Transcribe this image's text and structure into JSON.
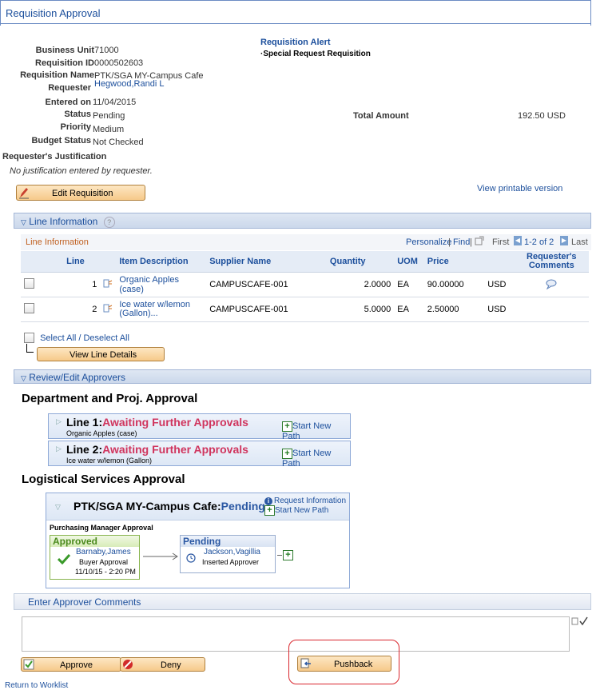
{
  "page": {
    "title": "Requisition Approval"
  },
  "header": {
    "business_unit_label": "Business Unit",
    "business_unit": "71000",
    "requisition_id_label": "Requisition ID",
    "requisition_id": "0000502603",
    "requisition_name_label": "Requisition Name",
    "requisition_name": "PTK/SGA MY-Campus Cafe",
    "requester_label": "Requester",
    "requester": "Hegwood,Randi L",
    "entered_on_label": "Entered on",
    "entered_on": "11/04/2015",
    "status_label": "Status",
    "status": "Pending",
    "priority_label": "Priority",
    "priority": "Medium",
    "budget_status_label": "Budget Status",
    "budget_status": "Not Checked",
    "justification_label": "Requester's Justification",
    "justification": "No justification entered by requester.",
    "alert_title": "Requisition Alert",
    "alert_text": "·Special Request Requisition",
    "total_label": "Total Amount",
    "total": "192.50 USD",
    "edit_button": "Edit Requisition",
    "printable": "View printable version"
  },
  "line_info": {
    "section_title": "Line Information",
    "grid_title": "Line Information",
    "personalize": "Personalize",
    "find": "Find",
    "first": "First",
    "range": "1-2 of 2",
    "last": "Last",
    "columns": [
      "Line",
      "Item Description",
      "Supplier Name",
      "Quantity",
      "UOM",
      "Price",
      "Requester's Comments"
    ],
    "rows": [
      {
        "line": "1",
        "desc": "Organic Apples (case)",
        "supplier": "CAMPUSCAFE-001",
        "qty": "2.0000",
        "uom": "EA",
        "price": "90.00000",
        "cur": "USD"
      },
      {
        "line": "2",
        "desc": "Ice water w/lemon (Gallon)...",
        "supplier": "CAMPUSCAFE-001",
        "qty": "5.0000",
        "uom": "EA",
        "price": "2.50000",
        "cur": "USD"
      }
    ],
    "select_all": "Select All / Deselect All",
    "view_details": "View Line Details"
  },
  "approvers": {
    "section_title": "Review/Edit Approvers",
    "dept_title": "Department and Proj. Approval",
    "line1_prefix": "Line 1:",
    "line1_status": "Awaiting Further Approvals",
    "line1_desc": "Organic Apples (case)",
    "line2_prefix": "Line 2:",
    "line2_status": "Awaiting Further Approvals",
    "line2_desc": "Ice water w/lemon (Gallon)",
    "start_new_path": "Start New Path",
    "log_title": "Logistical Services Approval",
    "log_name": "PTK/SGA MY-Campus Cafe:",
    "log_status": "Pending",
    "request_info": "Request Information",
    "stage": "Purchasing Manager Approval",
    "approved_header": "Approved",
    "approved_name": "Barnaby,James",
    "approved_role": "Buyer Approval",
    "approved_date": "11/10/15 - 2:20 PM",
    "pending_header": "Pending",
    "pending_name": "Jackson,Vagillia",
    "pending_role": "Inserted Approver"
  },
  "comments": {
    "section_title": "Enter Approver Comments",
    "value": ""
  },
  "actions": {
    "approve": "Approve",
    "deny": "Deny",
    "pushback": "Pushback",
    "return": "Return to Worklist"
  },
  "colors": {
    "link": "#1c4f9c",
    "awaiting": "#d0355e",
    "approved_green": "#2d7a2d",
    "highlight": "#d9272e"
  }
}
